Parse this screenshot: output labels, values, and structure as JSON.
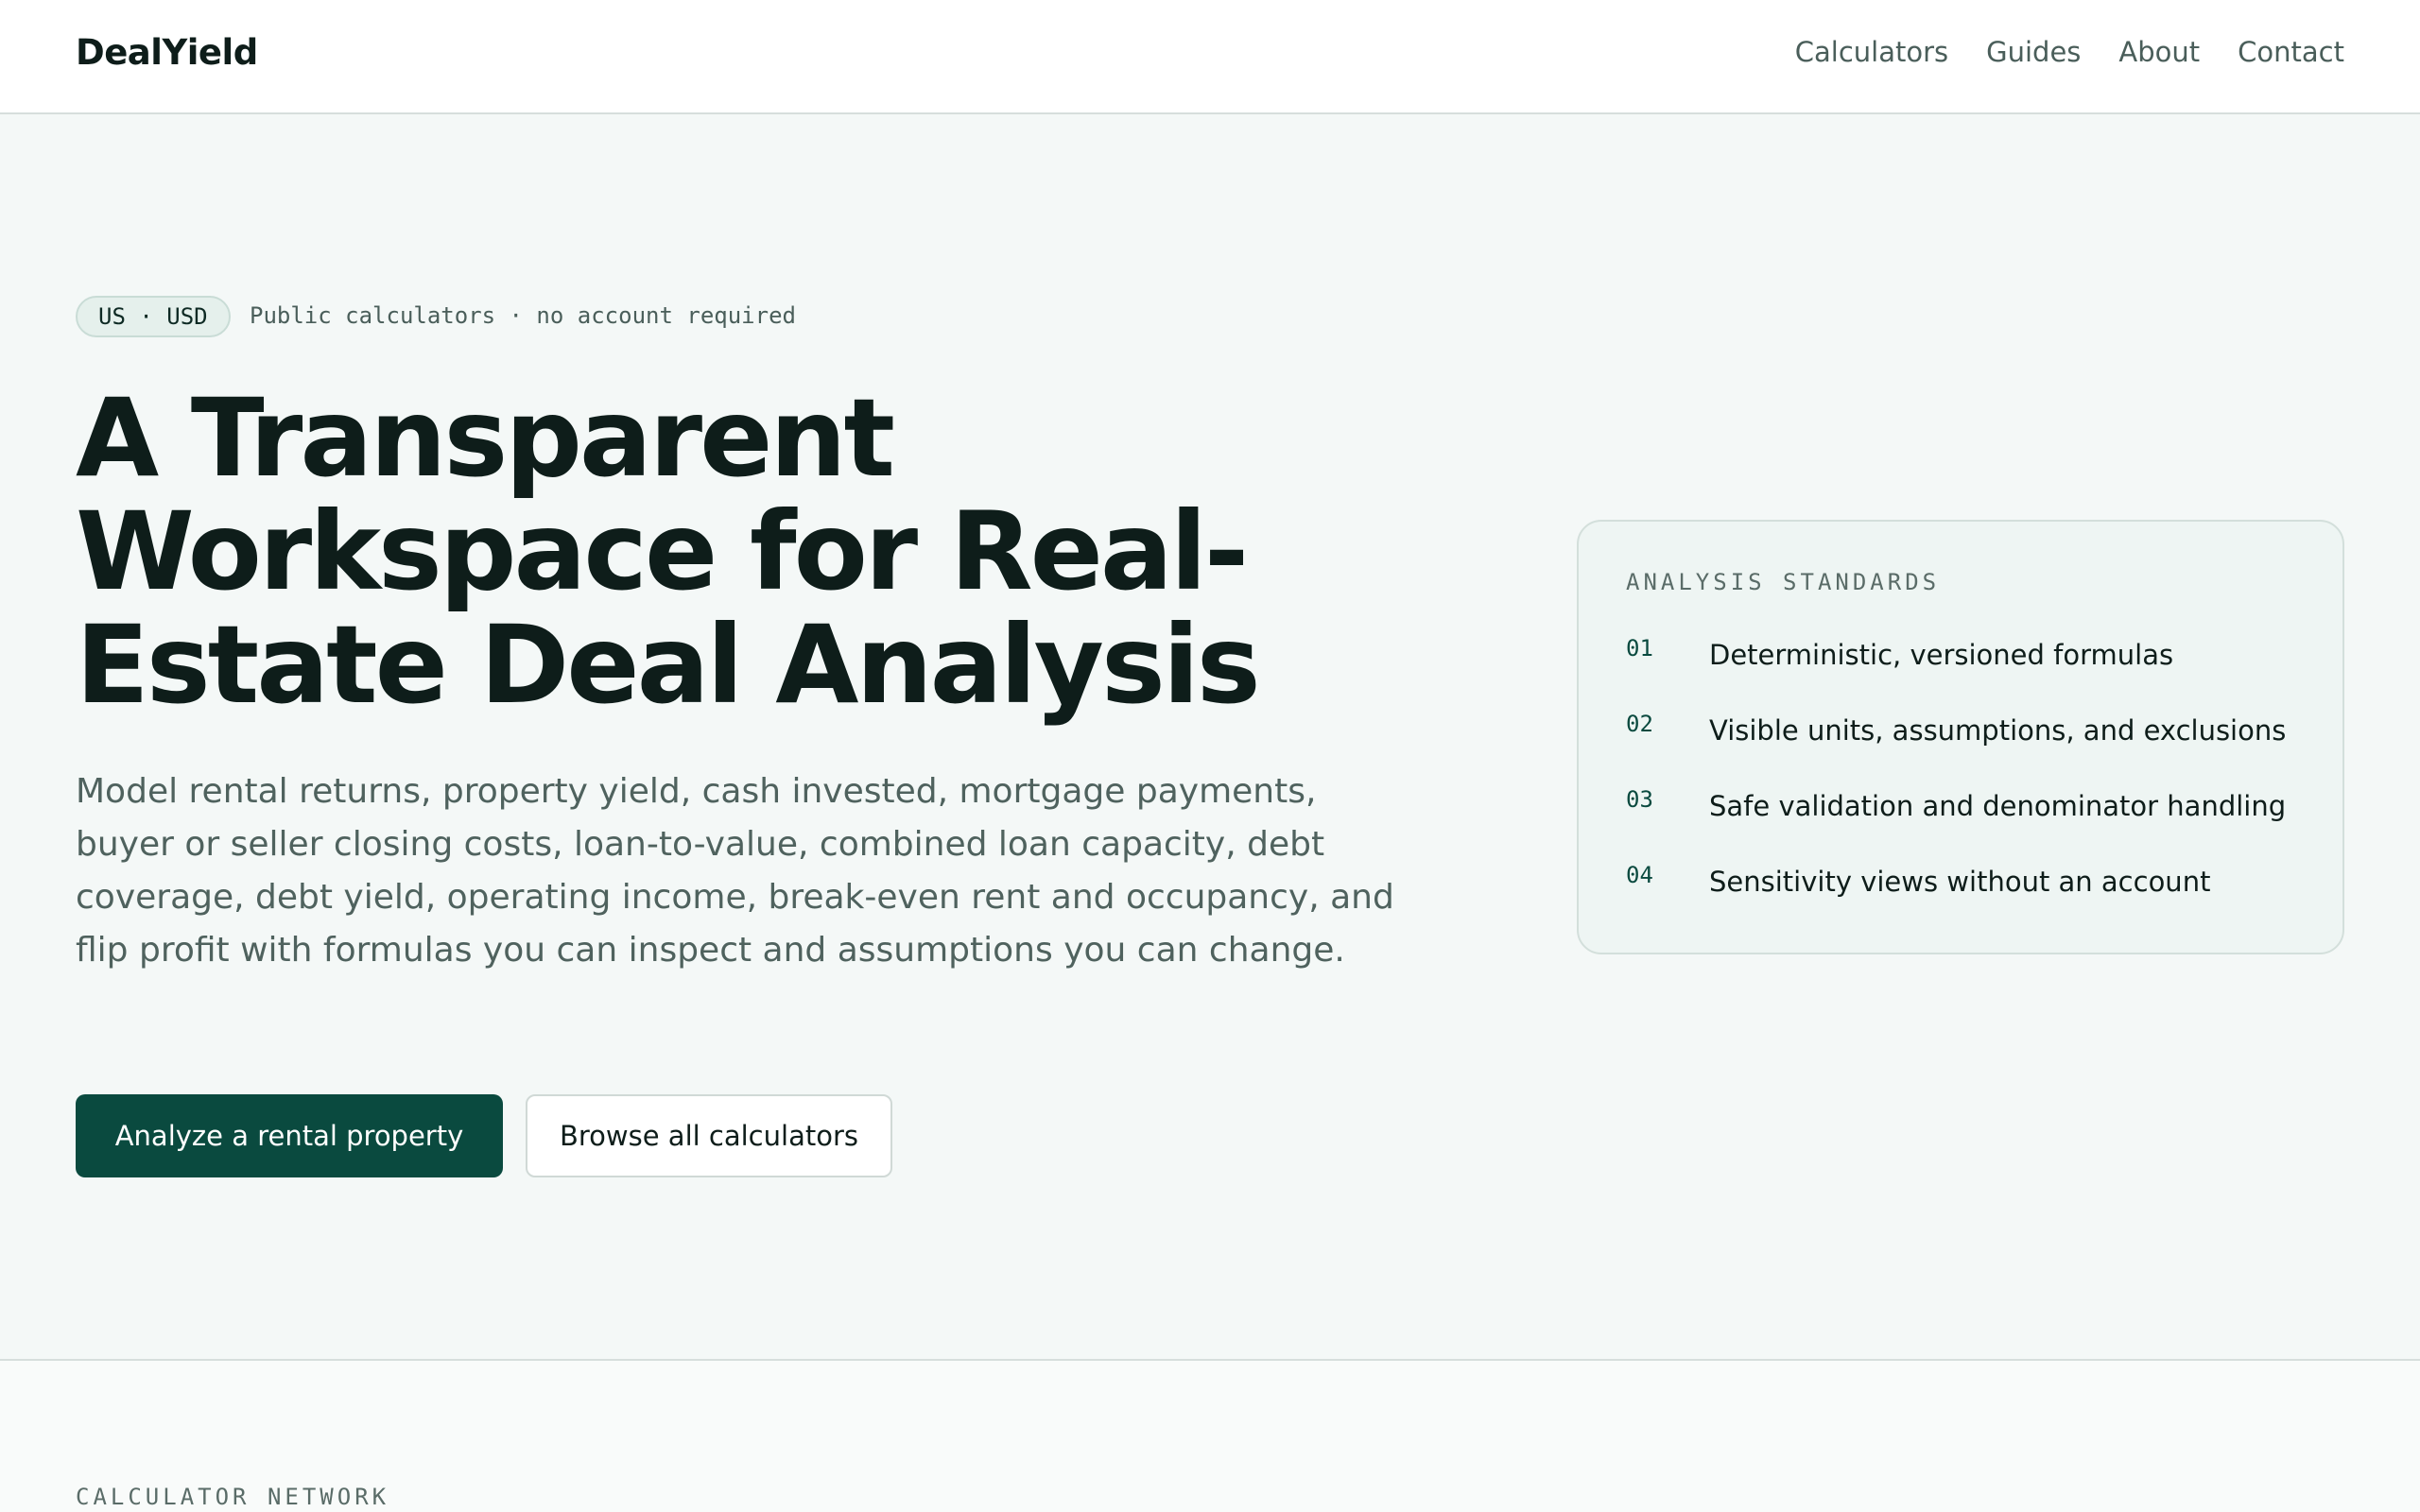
{
  "brand": "DealYield",
  "nav": {
    "links": [
      "Calculators",
      "Guides",
      "About",
      "Contact"
    ]
  },
  "hero": {
    "pill": "US · USD",
    "pill_note": "Public calculators · no account required",
    "title": "A Transparent Workspace for Real-Estate Deal Analysis",
    "description": "Model rental returns, property yield, cash invested, mortgage payments, buyer or seller closing costs, loan-to-value, combined loan capacity, debt coverage, debt yield, operating income, break-even rent and occupancy, and flip profit with formulas you can inspect and assumptions you can change.",
    "primary_button": "Analyze a rental property",
    "secondary_button": "Browse all calculators"
  },
  "standards": {
    "heading": "ANALYSIS STANDARDS",
    "items": [
      {
        "num": "01",
        "text": "Deterministic, versioned formulas"
      },
      {
        "num": "02",
        "text": "Visible units, assumptions, and exclusions"
      },
      {
        "num": "03",
        "text": "Safe validation and denominator handling"
      },
      {
        "num": "04",
        "text": "Sensitivity views without an account"
      }
    ]
  },
  "network": {
    "label": "CALCULATOR NETWORK"
  },
  "colors": {
    "accent": "#0a4a3f",
    "background": "#f4f8f7",
    "card": "#eef5f3"
  }
}
